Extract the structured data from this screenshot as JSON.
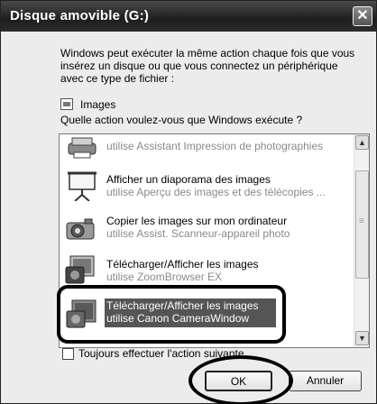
{
  "window": {
    "title": "Disque amovible (G:)",
    "close_glyph": "✕"
  },
  "intro_text": "Windows peut exécuter la même action chaque fois que vous insérez un disque ou que vous connectez un périphérique avec ce type de fichier :",
  "content_type": {
    "label": "Images",
    "icon": "image-file-icon"
  },
  "question": "Quelle action voulez-vous que Windows exécute ?",
  "actions": [
    {
      "title": "",
      "subtitle": "utilise Assistant Impression de photographies",
      "icon": "printer-icon"
    },
    {
      "title": "Afficher un diaporama des images",
      "subtitle": "utilise Aperçu des images et des télécopies ...",
      "icon": "projector-screen-icon"
    },
    {
      "title": "Copier les images sur mon ordinateur",
      "subtitle": "utilise Assist. Scanneur-appareil photo",
      "icon": "camera-icon"
    },
    {
      "title": "Télécharger/Afficher les images",
      "subtitle": "utilise ZoomBrowser EX",
      "icon": "zoombrowser-icon"
    },
    {
      "title": "Télécharger/Afficher les images",
      "subtitle": "utilise Canon CameraWindow",
      "icon": "camerawindow-icon",
      "selected": true
    }
  ],
  "scrollbar": {
    "up_glyph": "▲",
    "down_glyph": "▼"
  },
  "checkbox": {
    "label": "Toujours effectuer l'action suivante",
    "checked": false
  },
  "buttons": {
    "ok": "OK",
    "cancel": "Annuler"
  }
}
